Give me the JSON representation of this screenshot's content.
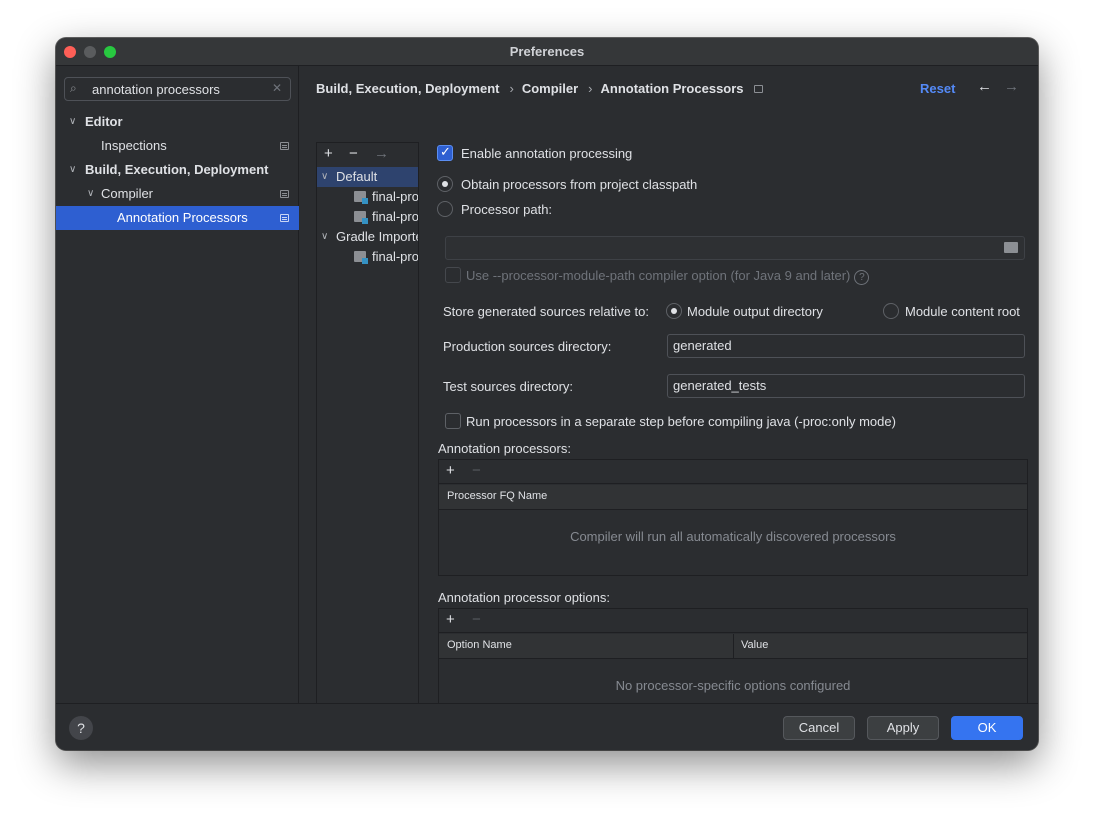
{
  "window": {
    "title": "Preferences"
  },
  "search": {
    "value": "annotation processors",
    "icon": "search-icon"
  },
  "sidebar": {
    "items": [
      {
        "label": "Editor",
        "bold": true
      },
      {
        "label": "Inspections"
      },
      {
        "label": "Build, Execution, Deployment",
        "bold": true
      },
      {
        "label": "Compiler"
      },
      {
        "label": "Annotation Processors",
        "selected": true
      }
    ]
  },
  "breadcrumb": {
    "parts": [
      "Build, Execution, Deployment",
      "Compiler",
      "Annotation Processors"
    ]
  },
  "header": {
    "reset": "Reset",
    "back": "←",
    "forward": "→"
  },
  "profiles": {
    "toolbar": {
      "add": "+",
      "remove": "−",
      "move": "→"
    },
    "items": [
      {
        "label": "Default",
        "group": true,
        "selected": true
      },
      {
        "label": "final-project"
      },
      {
        "label": "final-project"
      },
      {
        "label": "Gradle Imported",
        "group": true
      },
      {
        "label": "final-project"
      }
    ]
  },
  "form": {
    "enable": "Enable annotation processing",
    "obtain_classpath": "Obtain processors from project classpath",
    "processor_path": "Processor path:",
    "processor_path_value": "",
    "module_path_option": "Use --processor-module-path compiler option (for Java 9 and later)",
    "store_relative": "Store generated sources relative to:",
    "module_output": "Module output directory",
    "module_content": "Module content root",
    "prod_dir_label": "Production sources directory:",
    "prod_dir_value": "generated",
    "test_dir_label": "Test sources directory:",
    "test_dir_value": "generated_tests",
    "separate_step": "Run processors in a separate step before compiling java (-proc:only mode)"
  },
  "processors_table": {
    "title": "Annotation processors:",
    "add": "+",
    "remove": "−",
    "column": "Processor FQ Name",
    "empty": "Compiler will run all automatically discovered processors"
  },
  "options_table": {
    "title": "Annotation processor options:",
    "add": "+",
    "remove": "−",
    "col_name": "Option Name",
    "col_value": "Value",
    "empty": "No processor-specific options configured"
  },
  "footer": {
    "help": "?",
    "cancel": "Cancel",
    "apply": "Apply",
    "ok": "OK"
  },
  "colors": {
    "accent": "#2e5fd1",
    "link": "#548af7",
    "background": "#2b2d30"
  }
}
